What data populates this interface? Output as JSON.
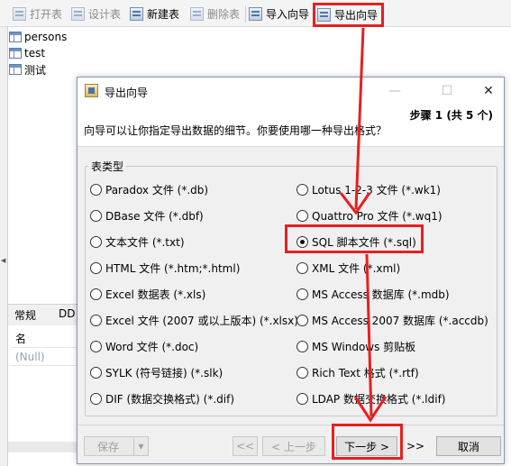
{
  "toolbar": {
    "open": "打开表",
    "design": "设计表",
    "new": "新建表",
    "delete": "删除表",
    "import": "导入向导",
    "export": "导出向导"
  },
  "tables": [
    "persons",
    "test",
    "测试"
  ],
  "property_panel": {
    "tabs": [
      "常规",
      "DD"
    ],
    "rows": [
      "名",
      "(Null)"
    ]
  },
  "dialog": {
    "title": "导出向导",
    "step": "步骤 1 (共 5 个)",
    "prompt": "向导可以让你指定导出数据的细节。你要使用哪一种导出格式？",
    "group_label": "表类型",
    "formats_left": [
      "Paradox 文件 (*.db)",
      "DBase 文件 (*.dbf)",
      "文本文件 (*.txt)",
      "HTML 文件 (*.htm;*.html)",
      "Excel 数据表 (*.xls)",
      "Excel 文件 (2007 或以上版本) (*.xlsx)",
      "Word 文件 (*.doc)",
      "SYLK (符号链接) (*.slk)",
      "DIF (数据交换格式) (*.dif)"
    ],
    "formats_right": [
      "Lotus 1-2-3 文件 (*.wk1)",
      "Quattro Pro 文件 (*.wq1)",
      "SQL 脚本文件 (*.sql)",
      "XML 文件 (*.xml)",
      "MS Access 数据库 (*.mdb)",
      "MS Access 2007 数据库 (*.accdb)",
      "MS Windows 剪贴板",
      "Rich Text 格式 (*.rtf)",
      "LDAP 数据交换格式 (*.ldif)"
    ],
    "selected_format": "SQL 脚本文件 (*.sql)",
    "buttons": {
      "save": "保存",
      "first": "<<",
      "prev": "< 上一步",
      "next": "下一步 >",
      "last": ">>",
      "cancel": "取消"
    }
  },
  "colors": {
    "highlight": "#e6201f"
  }
}
